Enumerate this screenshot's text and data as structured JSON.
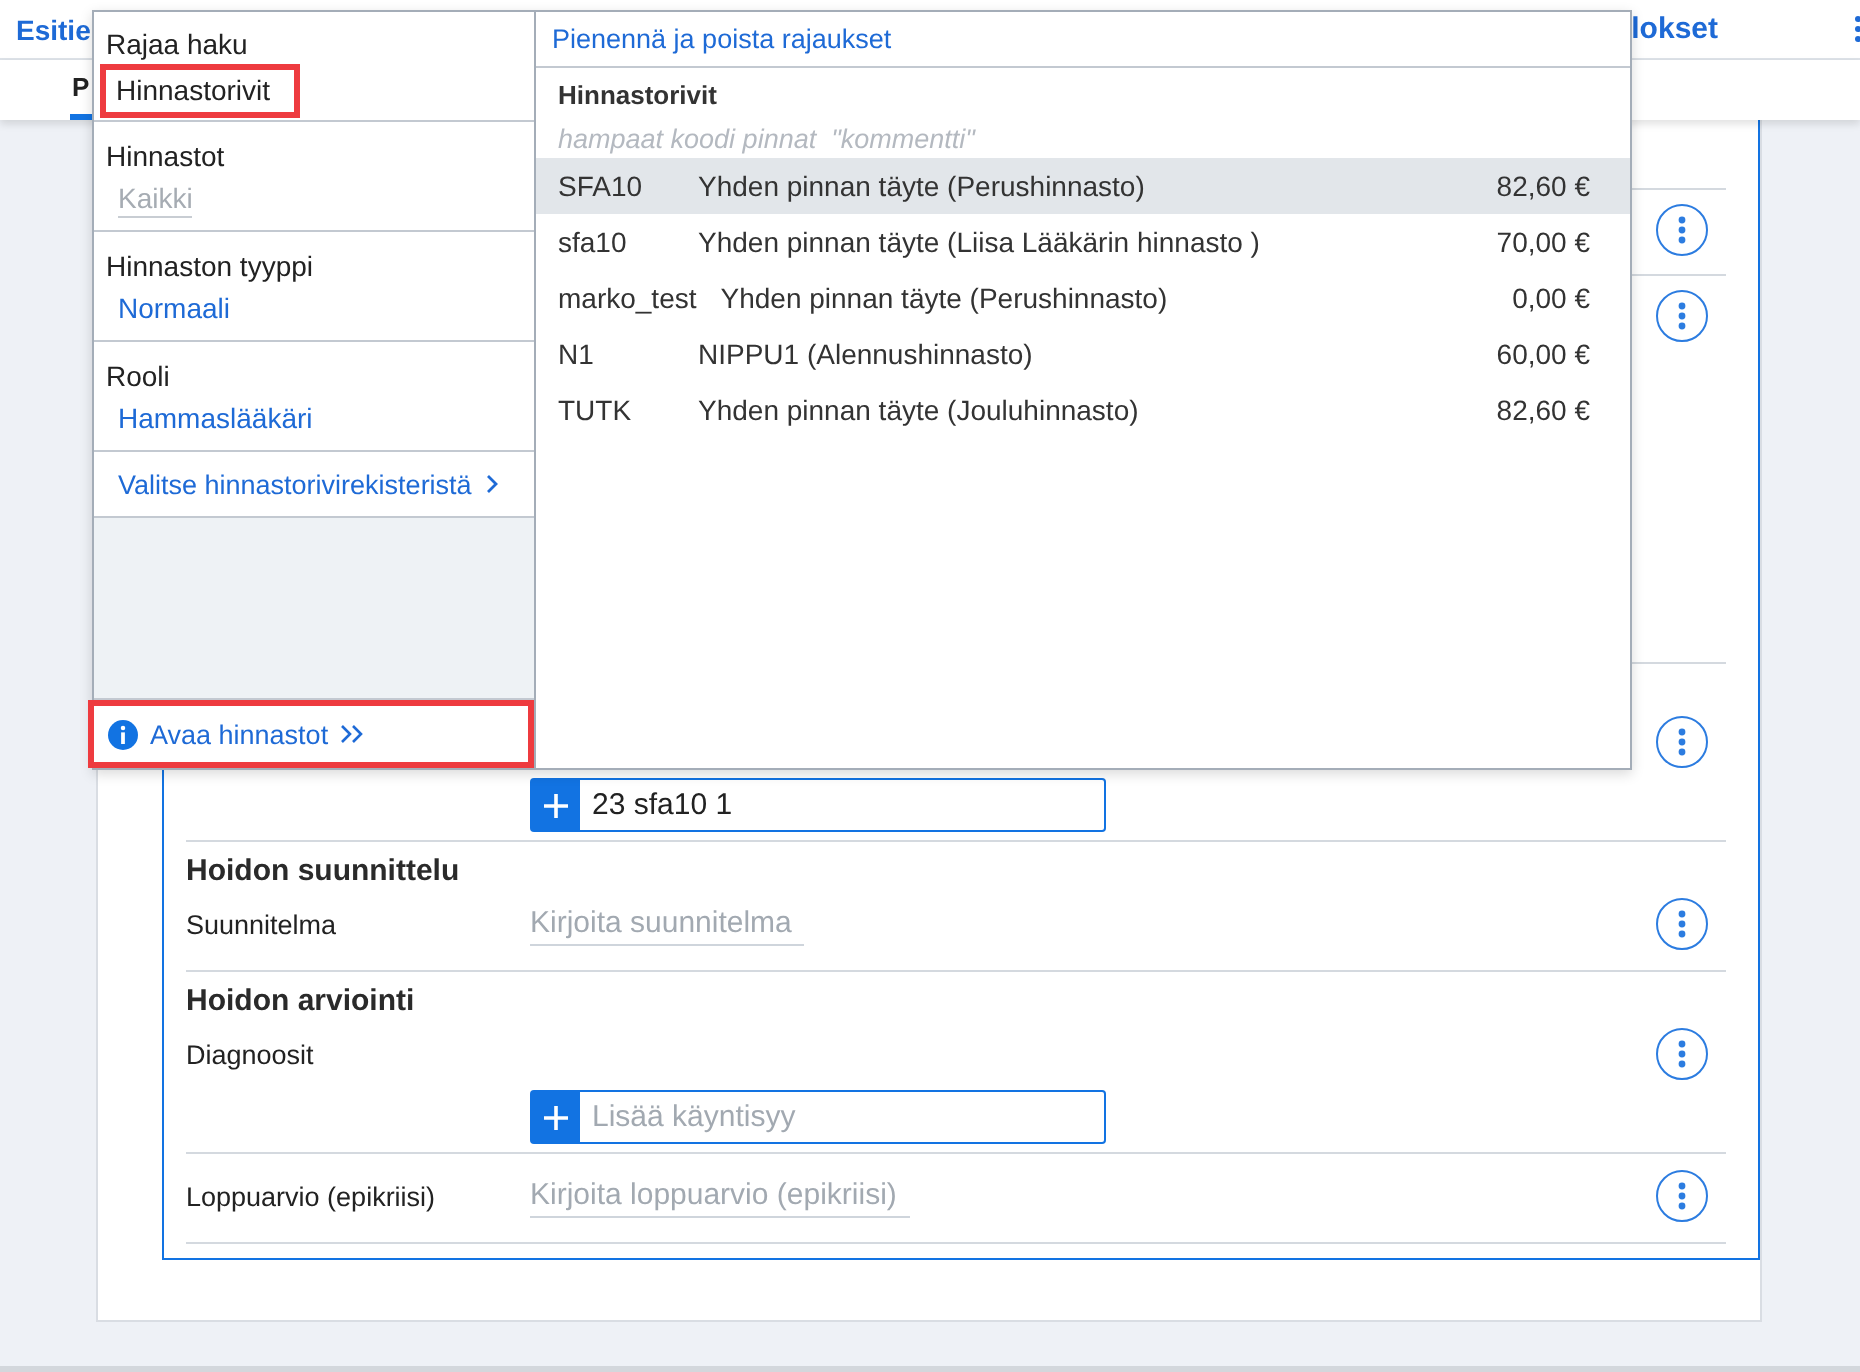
{
  "header": {
    "nav_tabs": [
      {
        "label": "Esitie"
      },
      {
        "label": "lokset"
      }
    ],
    "sub_tabs": [
      {
        "label": "P",
        "selected": true
      }
    ]
  },
  "record": {
    "rows": [
      {
        "kind": "covered",
        "has_menu": false
      },
      {
        "kind": "covered",
        "has_menu": true
      },
      {
        "kind": "covered",
        "has_menu": true
      },
      {
        "kind": "add",
        "has_menu": true,
        "add_field": {
          "value": "23 sfa10 1"
        }
      },
      {
        "kind": "text",
        "heading": "Hoidon suunnittelu",
        "label": "Suunnitelma",
        "placeholder": "Kirjoita suunnitelma",
        "has_menu": true
      },
      {
        "kind": "add",
        "heading": "Hoidon arviointi",
        "label": "Diagnoosit",
        "has_menu": true,
        "add_field": {
          "placeholder": "Lisää käyntisyy"
        }
      },
      {
        "kind": "text",
        "label": "Loppuarvio (epikriisi)",
        "placeholder": "Kirjoita loppuarvio (epikriisi)",
        "has_menu": true
      }
    ]
  },
  "popup": {
    "scope": {
      "label": "Rajaa haku",
      "value": "Hinnastorivit",
      "highlighted": true
    },
    "filters": [
      {
        "label": "Hinnastot",
        "value": "Kaikki",
        "dimmed": true
      },
      {
        "label": "Hinnaston tyyppi",
        "value": "Normaali",
        "dimmed": false
      },
      {
        "label": "Rooli",
        "value": "Hammaslääkäri",
        "dimmed": false
      }
    ],
    "register_link": "Valitse hinnastorivirekisteristä",
    "open_link": {
      "label": "Avaa hinnastot",
      "highlighted": true
    },
    "reset_link": "Pienennä ja poista rajaukset",
    "results": {
      "title": "Hinnastorivit",
      "search": {
        "placeholder": "hampaat koodi pinnat  \"kommentti\""
      },
      "rows": [
        {
          "code": "SFA10",
          "name": "Yhden pinnan täyte (Perushinnasto)",
          "price": "82,60 €",
          "selected": true
        },
        {
          "code": "sfa10",
          "name": "Yhden pinnan täyte (Liisa Lääkärin hinnasto )",
          "price": "70,00 €",
          "selected": false
        },
        {
          "code": "marko_test",
          "name": "Yhden pinnan täyte (Perushinnasto)",
          "price": "0,00 €",
          "selected": false
        },
        {
          "code": "N1",
          "name": "NIPPU1 (Alennushinnasto)",
          "price": "60,00 €",
          "selected": false
        },
        {
          "code": "TUTK",
          "name": "Yhden pinnan täyte (Jouluhinnasto)",
          "price": "82,60 €",
          "selected": false
        }
      ]
    }
  }
}
